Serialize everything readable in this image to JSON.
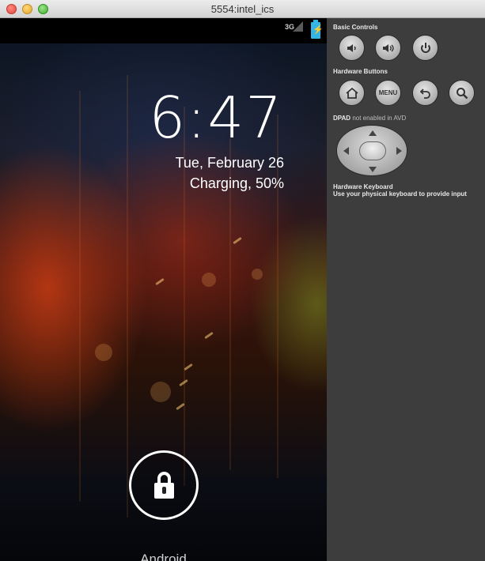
{
  "window": {
    "title": "5554:intel_ics"
  },
  "statusbar": {
    "network": "3G",
    "accent_color": "#33b5e5"
  },
  "lockscreen": {
    "time": "6:47",
    "date": "Tue, February 26",
    "charging": "Charging, 50%",
    "carrier": "Android"
  },
  "panel": {
    "basic_controls_label": "Basic Controls",
    "hardware_buttons_label": "Hardware Buttons",
    "menu_label": "MENU",
    "dpad_label": "DPAD",
    "dpad_note": "not enabled in AVD",
    "keyboard_label": "Hardware Keyboard",
    "keyboard_note": "Use your physical keyboard to provide input"
  }
}
